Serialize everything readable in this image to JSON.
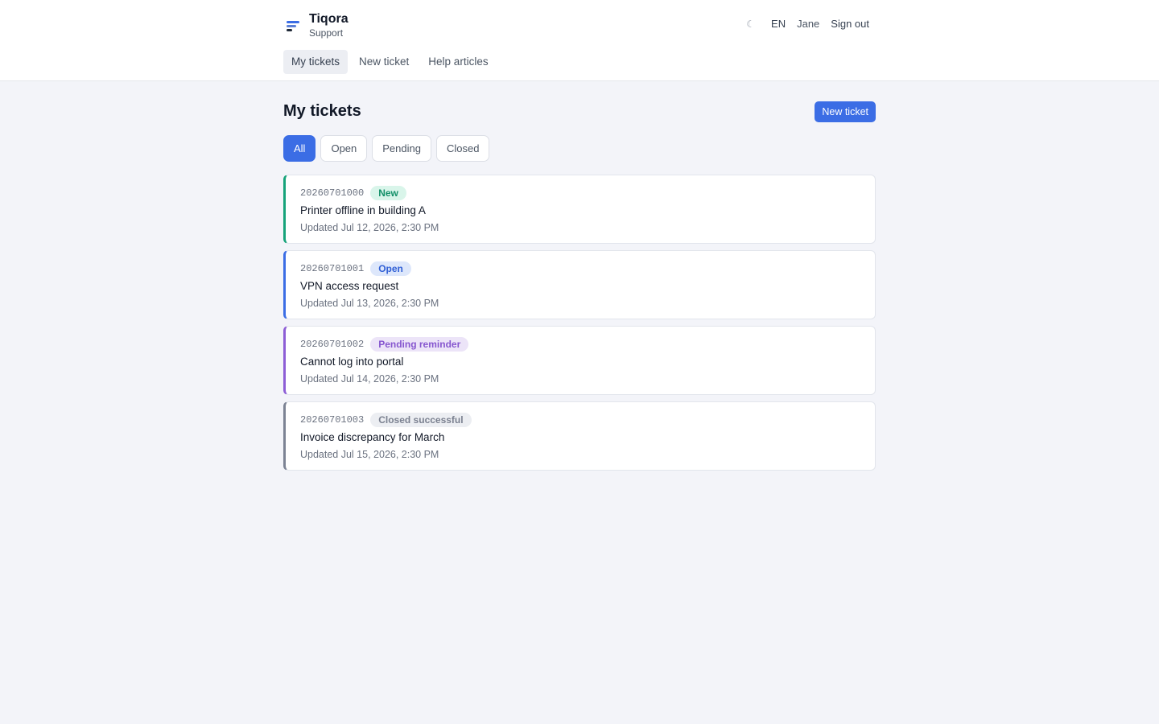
{
  "brand": {
    "name": "Tiqora",
    "subtitle": "Support",
    "icon": "menu-lines-icon"
  },
  "top_actions": {
    "theme_icon": "☾",
    "language": "EN",
    "user": "Jane",
    "sign_out": "Sign out"
  },
  "nav": [
    {
      "label": "My tickets",
      "active": true
    },
    {
      "label": "New ticket",
      "active": false
    },
    {
      "label": "Help articles",
      "active": false
    }
  ],
  "page": {
    "title": "My tickets",
    "new_ticket_button": "New ticket"
  },
  "filters": [
    {
      "label": "All",
      "active": true
    },
    {
      "label": "Open",
      "active": false
    },
    {
      "label": "Pending",
      "active": false
    },
    {
      "label": "Closed",
      "active": false
    }
  ],
  "tickets": [
    {
      "id": "20260701000",
      "status": "New",
      "title": "Printer offline in building A",
      "updated": "Updated Jul 12, 2026, 2:30 PM",
      "accent": "#16a37a",
      "badge_bg": "#d9f5ea",
      "badge_fg": "#129068"
    },
    {
      "id": "20260701001",
      "status": "Open",
      "title": "VPN access request",
      "updated": "Updated Jul 13, 2026, 2:30 PM",
      "accent": "#3b6de5",
      "badge_bg": "#dde7fb",
      "badge_fg": "#3160d6"
    },
    {
      "id": "20260701002",
      "status": "Pending reminder",
      "title": "Cannot log into portal",
      "updated": "Updated Jul 14, 2026, 2:30 PM",
      "accent": "#8d5ed6",
      "badge_bg": "#ece4f8",
      "badge_fg": "#8656cf"
    },
    {
      "id": "20260701003",
      "status": "Closed successful",
      "title": "Invoice discrepancy for March",
      "updated": "Updated Jul 15, 2026, 2:30 PM",
      "accent": "#7c8394",
      "badge_bg": "#eceef2",
      "badge_fg": "#7b8190"
    }
  ],
  "colors": {
    "primary": "#3b6de5",
    "background": "#f3f4f9"
  }
}
